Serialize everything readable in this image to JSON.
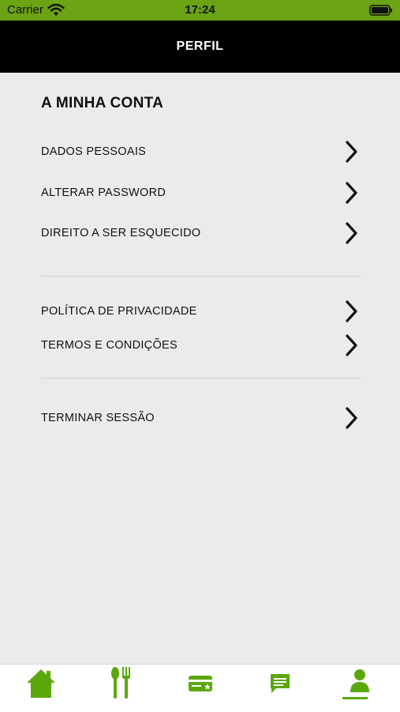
{
  "status_bar": {
    "carrier": "Carrier",
    "time": "17:24",
    "wifi_icon": "wifi-icon",
    "battery_icon": "battery-icon",
    "background_color": "#6aa313"
  },
  "nav": {
    "title": "PERFIL",
    "background_color": "#000000"
  },
  "account": {
    "title": "A MINHA CONTA",
    "items": [
      {
        "label": "DADOS PESSOAIS",
        "icon": "chevron-right-icon"
      },
      {
        "label": "ALTERAR PASSWORD",
        "icon": "chevron-right-icon"
      },
      {
        "label": "DIREITO A SER ESQUECIDO",
        "icon": "chevron-right-icon"
      }
    ]
  },
  "legal": {
    "items": [
      {
        "label": "POLÍTICA DE PRIVACIDADE",
        "icon": "chevron-right-icon"
      },
      {
        "label": "TERMOS E CONDIÇÕES",
        "icon": "chevron-right-icon"
      }
    ]
  },
  "session": {
    "items": [
      {
        "label": "TERMINAR SESSÃO",
        "icon": "chevron-right-icon"
      }
    ]
  },
  "tab_bar": {
    "accent_color": "#5aa80c",
    "tabs": [
      {
        "icon": "home-icon",
        "selected": false
      },
      {
        "icon": "fork-knife-icon",
        "selected": false
      },
      {
        "icon": "card-icon",
        "selected": false
      },
      {
        "icon": "message-icon",
        "selected": false
      },
      {
        "icon": "profile-icon",
        "selected": true
      }
    ]
  }
}
